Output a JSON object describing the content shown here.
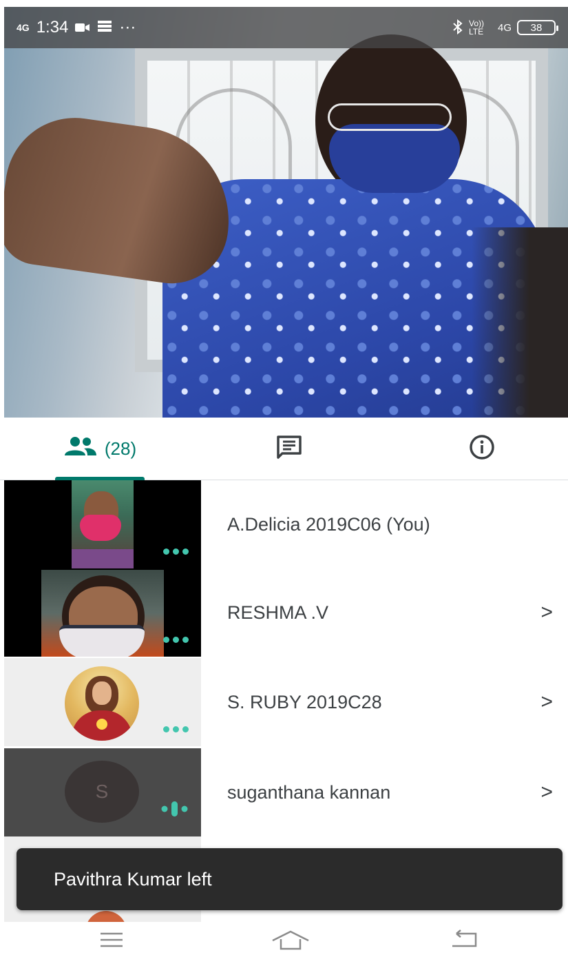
{
  "status_bar": {
    "network": "4G",
    "time": "1:34",
    "more": "···",
    "volte": "Vo)) LTE",
    "network_right": "4G",
    "battery": "38"
  },
  "tabs": {
    "people_count": "(28)"
  },
  "participants": [
    {
      "name": "A.Delicia 2019C06 (You)",
      "has_chevron": false
    },
    {
      "name": "RESHMA .V",
      "has_chevron": true
    },
    {
      "name": "S. RUBY 2019C28",
      "has_chevron": true
    },
    {
      "name": "suganthana kannan",
      "has_chevron": true,
      "avatar_letter": "S"
    }
  ],
  "chevron": ">",
  "snackbar": {
    "message": "Pavithra Kumar left"
  },
  "colors": {
    "accent": "#00796b",
    "dots": "#43c6ae",
    "snackbar_bg": "#2b2b2b"
  },
  "icons": [
    "people-icon",
    "chat-icon",
    "info-icon",
    "menu-icon",
    "home-icon",
    "back-icon",
    "bluetooth-icon",
    "camera-icon",
    "data-icon"
  ]
}
